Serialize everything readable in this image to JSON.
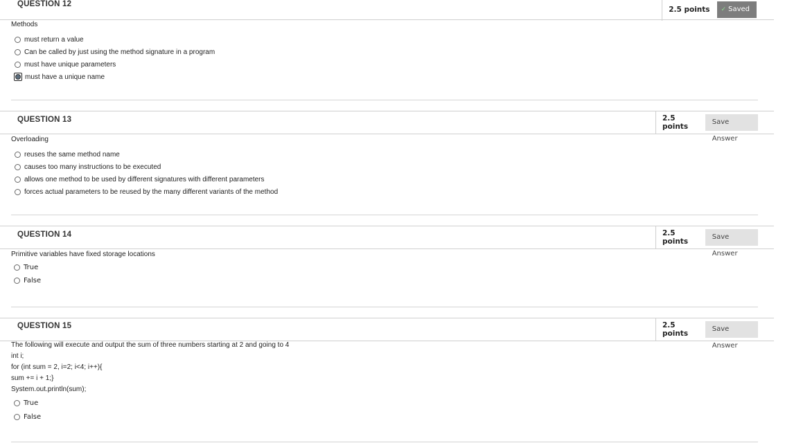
{
  "questions": [
    {
      "title": "QUESTION 12",
      "points": "2.5 points",
      "action": "Saved",
      "prompt": [
        "Methods"
      ],
      "options": [
        "must return a value",
        "Can be called by just using the method signature in a program",
        "must have unique parameters",
        "must have a unique name"
      ],
      "selected_option": "must have a unique name"
    },
    {
      "title": "QUESTION 13",
      "points": "2.5 points",
      "action": "Save Answer",
      "prompt": [
        "Overloading"
      ],
      "options": [
        "reuses the same method name",
        "causes too many instructions to be executed",
        "allows one method to be used by different signatures with different parameters",
        "forces actual parameters to be reused by the many different variants of the method"
      ]
    },
    {
      "title": "QUESTION 14",
      "points": "2.5 points",
      "action": "Save Answer",
      "prompt": [
        "Primitive variables have fixed storage locations"
      ],
      "options": [
        "True",
        "False"
      ]
    },
    {
      "title": "QUESTION 15",
      "points": "2.5 points",
      "action": "Save Answer",
      "prompt": [
        "The following will execute and output the sum of three numbers starting at 2 and going to 4",
        "int i;",
        "for (int sum = 2, i=2; i<4; i++){",
        "sum += i + 1;}",
        "System.out.println(sum);"
      ],
      "options": [
        "True",
        "False"
      ]
    }
  ]
}
